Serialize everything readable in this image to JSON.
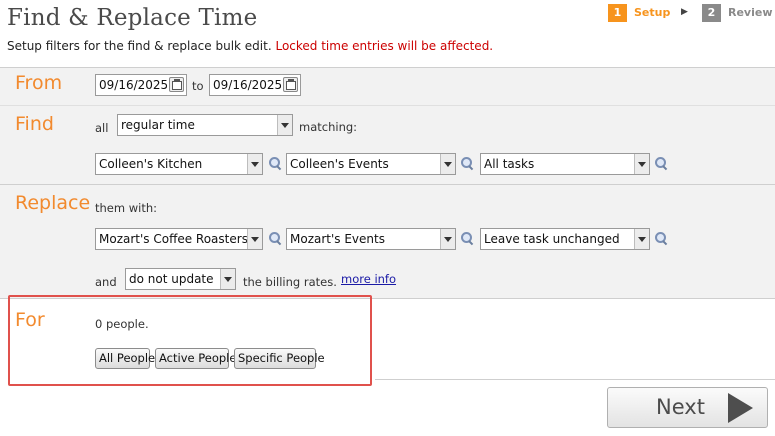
{
  "header": {
    "title": "Find & Replace Time",
    "subtitle": "Setup filters for the find & replace bulk edit.",
    "warning": "Locked time entries will be affected."
  },
  "steps": [
    {
      "number": "1",
      "label": "Setup",
      "active": true,
      "color": "#f7941d"
    },
    {
      "number": "2",
      "label": "Review",
      "active": false,
      "color": "#8a8a8a"
    }
  ],
  "from": {
    "label": "From",
    "start_date": "09/16/2025",
    "to_text": "to",
    "end_date": "09/16/2025"
  },
  "find": {
    "label": "Find",
    "all_text": "all",
    "time_type": "regular time",
    "matching_text": "matching:",
    "client": "Colleen's Kitchen",
    "project": "Colleen's Events",
    "task": "All tasks"
  },
  "replace": {
    "label": "Replace",
    "with_text": "them with:",
    "client": "Mozart's Coffee Roasters",
    "project": "Mozart's Events",
    "task": "Leave task unchanged",
    "and_text": "and",
    "billing_option": "do not update",
    "billing_text": "the billing rates.",
    "more_info": "more info"
  },
  "for": {
    "label": "For",
    "count_text": "0 people.",
    "buttons": [
      "All People",
      "Active People",
      "Specific People"
    ]
  },
  "footer": {
    "next_label": "Next"
  },
  "colors": {
    "accent": "#f28a2e",
    "highlight": "#e0514c",
    "warning": "#cc0000"
  },
  "icons": [
    "calendar-icon",
    "magnifier-icon",
    "dropdown-arrow-icon",
    "next-arrow-icon"
  ]
}
